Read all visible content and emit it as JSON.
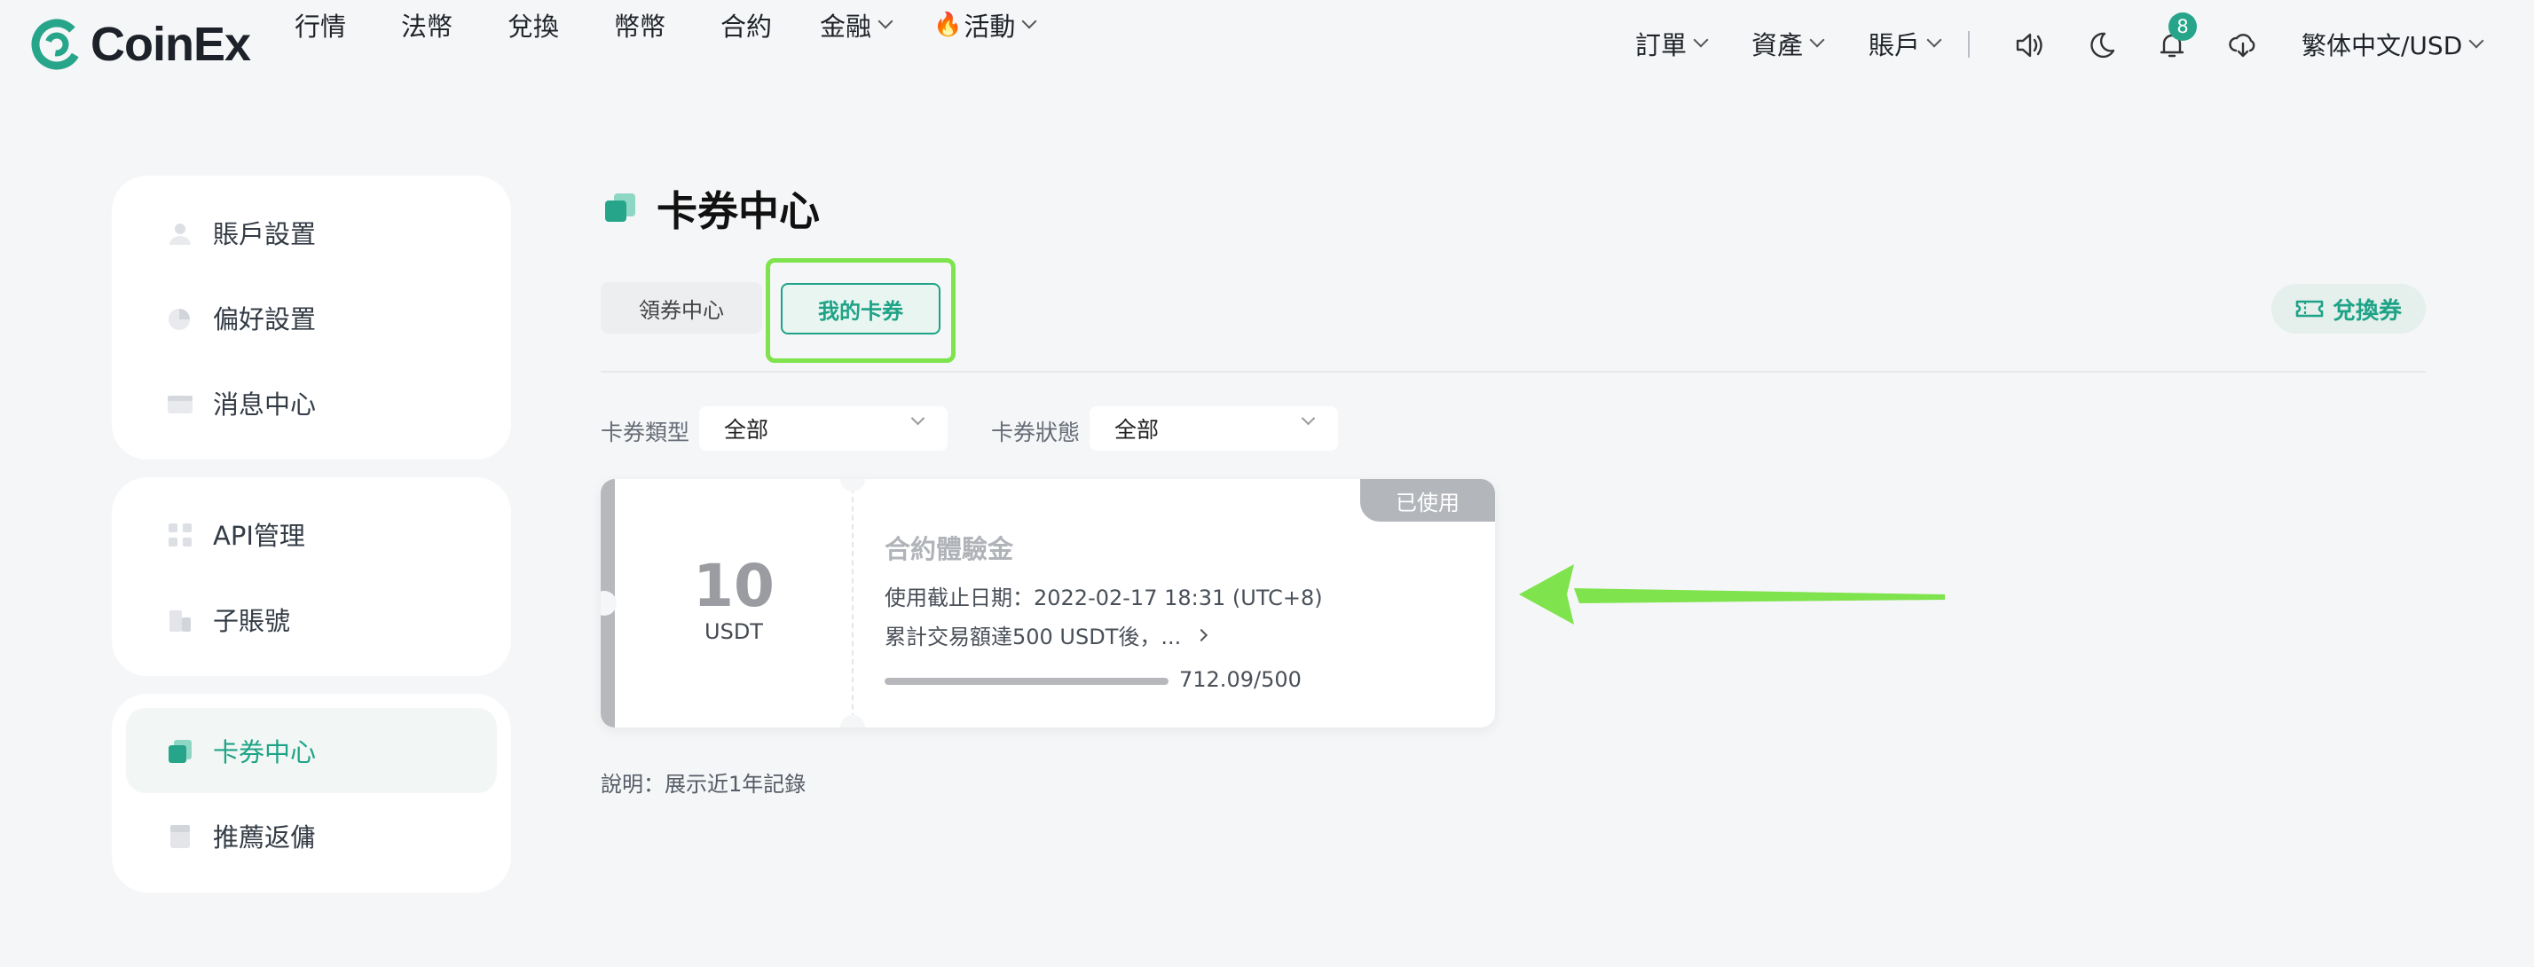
{
  "brand": {
    "name": "CoinEx",
    "accent": "#27a58a"
  },
  "nav": {
    "left": [
      {
        "label": "行情"
      },
      {
        "label": "法幣"
      },
      {
        "label": "兌換"
      },
      {
        "label": "幣幣"
      },
      {
        "label": "合約"
      },
      {
        "label": "金融"
      },
      {
        "label": "活動"
      }
    ],
    "right": [
      {
        "label": "訂單"
      },
      {
        "label": "資產"
      },
      {
        "label": "賬戶"
      }
    ],
    "notification_count": "8",
    "language": "繁体中文/USD",
    "fire_glyph": "🔥"
  },
  "sidebar": {
    "group1": [
      {
        "label": "賬戶設置",
        "icon": "user-icon"
      },
      {
        "label": "偏好設置",
        "icon": "preference-icon"
      },
      {
        "label": "消息中心",
        "icon": "message-icon"
      }
    ],
    "group2": [
      {
        "label": "API管理",
        "icon": "api-icon"
      },
      {
        "label": "子賬號",
        "icon": "subaccount-icon"
      }
    ],
    "group3": [
      {
        "label": "卡券中心",
        "icon": "coupon-icon",
        "active": true
      },
      {
        "label": "推薦返傭",
        "icon": "referral-icon"
      }
    ]
  },
  "main": {
    "title": "卡券中心",
    "tabs": [
      {
        "label": "領券中心",
        "active": false
      },
      {
        "label": "我的卡券",
        "active": true
      }
    ],
    "redeem_label": "兌換券",
    "filters": {
      "type_label": "卡券類型",
      "type_value": "全部",
      "status_label": "卡券狀態",
      "status_value": "全部"
    },
    "coupon": {
      "amount": "10",
      "unit": "USDT",
      "status": "已使用",
      "name": "合約體驗金",
      "expiry": "使用截止日期：2022-02-17 18:31 (UTC+8)",
      "condition": "累計交易額達500 USDT後，...",
      "progress_text": "712.09/500",
      "progress_fraction": 1.0
    },
    "note": "說明：展示近1年記錄"
  }
}
